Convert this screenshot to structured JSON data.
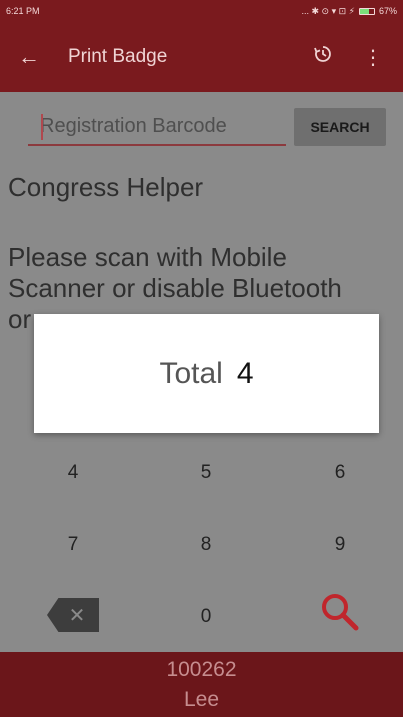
{
  "status_bar": {
    "time": "6:21 PM",
    "icons": "... ✱ ⊙ ▾ ⊡ ⚡",
    "battery": "67%",
    "battery_level": 0.67
  },
  "toolbar": {
    "back_icon": "arrow-left",
    "title": "Print Badge",
    "history_icon": "history",
    "more_icon": "more-vertical"
  },
  "search": {
    "placeholder": "Registration Barcode",
    "value": "",
    "button_label": "SEARCH"
  },
  "helper_title": "Congress Helper",
  "instruction": "Please scan with Mobile\nScanner or disable Bluetooth\nor",
  "keypad": {
    "row1": [
      "4",
      "5",
      "6"
    ],
    "row2": [
      "7",
      "8",
      "9"
    ],
    "zero": "0",
    "backspace_icon": "backspace",
    "search_icon": "magnifier"
  },
  "bottom": {
    "code": "100262",
    "name": "Lee"
  },
  "dialog": {
    "label": "Total",
    "value": "4"
  },
  "colors": {
    "primary": "#7a1a1e",
    "accent": "#c0262c"
  }
}
